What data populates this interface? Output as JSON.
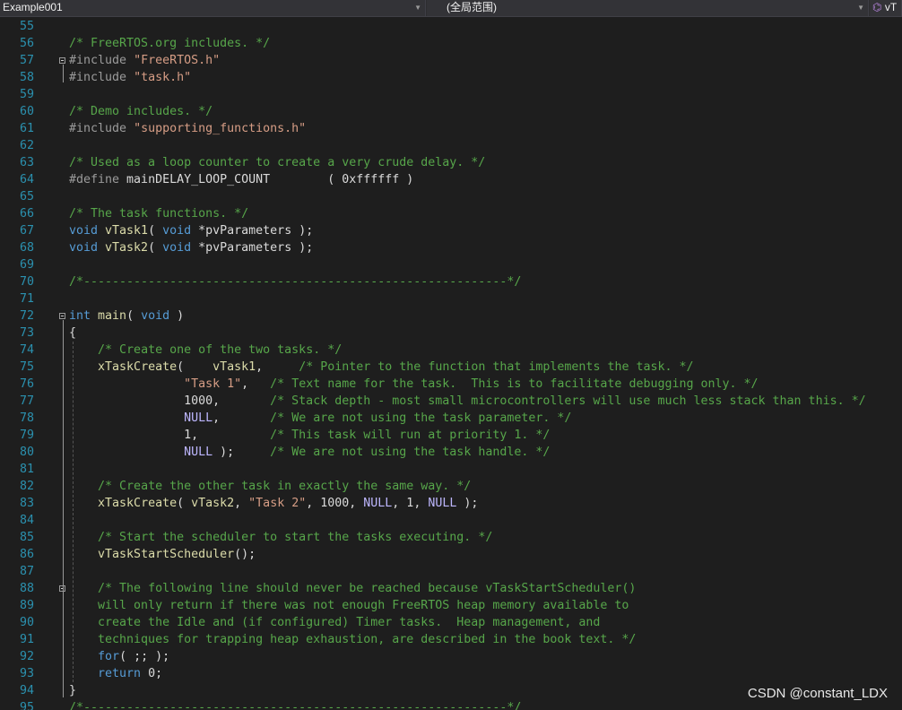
{
  "navbar": {
    "project": "Example001",
    "scope": "(全局范围)",
    "member": "vT",
    "member_icon": "method-icon"
  },
  "watermark": "CSDN @constant_LDX",
  "colors": {
    "background": "#1e1e1e",
    "line_number": "#2b91af",
    "comment": "#57a64a",
    "keyword": "#569cd6",
    "function": "#dcdcaa",
    "string": "#d69d85",
    "macro": "#beb7ff"
  },
  "lines": [
    {
      "n": "55",
      "t": []
    },
    {
      "n": "56",
      "t": [
        [
          "comment",
          "/* FreeRTOS.org includes. */"
        ]
      ]
    },
    {
      "n": "57",
      "t": [
        [
          "pp",
          "#include "
        ],
        [
          "str",
          "\"FreeRTOS.h\""
        ]
      ]
    },
    {
      "n": "58",
      "t": [
        [
          "pp",
          "#include "
        ],
        [
          "str",
          "\"task.h\""
        ]
      ]
    },
    {
      "n": "59",
      "t": []
    },
    {
      "n": "60",
      "t": [
        [
          "comment",
          "/* Demo includes. */"
        ]
      ]
    },
    {
      "n": "61",
      "t": [
        [
          "pp",
          "#include "
        ],
        [
          "str",
          "\"supporting_functions.h\""
        ]
      ]
    },
    {
      "n": "62",
      "t": []
    },
    {
      "n": "63",
      "t": [
        [
          "comment",
          "/* Used as a loop counter to create a very crude delay. */"
        ]
      ]
    },
    {
      "n": "64",
      "t": [
        [
          "pp",
          "#define "
        ],
        [
          "plain",
          "mainDELAY_LOOP_COUNT        ( 0xffffff )"
        ]
      ]
    },
    {
      "n": "65",
      "t": []
    },
    {
      "n": "66",
      "t": [
        [
          "comment",
          "/* The task functions. */"
        ]
      ]
    },
    {
      "n": "67",
      "t": [
        [
          "kw",
          "void "
        ],
        [
          "fn",
          "vTask1"
        ],
        [
          "plain",
          "( "
        ],
        [
          "kw",
          "void "
        ],
        [
          "plain",
          "*pvParameters );"
        ]
      ]
    },
    {
      "n": "68",
      "t": [
        [
          "kw",
          "void "
        ],
        [
          "fn",
          "vTask2"
        ],
        [
          "plain",
          "( "
        ],
        [
          "kw",
          "void "
        ],
        [
          "plain",
          "*pvParameters );"
        ]
      ]
    },
    {
      "n": "69",
      "t": []
    },
    {
      "n": "70",
      "t": [
        [
          "comment",
          "/*-----------------------------------------------------------*/"
        ]
      ]
    },
    {
      "n": "71",
      "t": []
    },
    {
      "n": "72",
      "t": [
        [
          "kw",
          "int "
        ],
        [
          "fn",
          "main"
        ],
        [
          "plain",
          "( "
        ],
        [
          "kw",
          "void "
        ],
        [
          "plain",
          ")"
        ]
      ]
    },
    {
      "n": "73",
      "t": [
        [
          "plain",
          "{"
        ]
      ]
    },
    {
      "n": "74",
      "t": [
        [
          "plain",
          "    "
        ],
        [
          "comment",
          "/* Create one of the two tasks. */"
        ]
      ]
    },
    {
      "n": "75",
      "t": [
        [
          "plain",
          "    "
        ],
        [
          "fn",
          "xTaskCreate"
        ],
        [
          "plain",
          "(    "
        ],
        [
          "fn",
          "vTask1"
        ],
        [
          "plain",
          ",     "
        ],
        [
          "comment",
          "/* Pointer to the function that implements the task. */"
        ]
      ]
    },
    {
      "n": "76",
      "t": [
        [
          "plain",
          "                "
        ],
        [
          "str",
          "\"Task 1\""
        ],
        [
          "plain",
          ",   "
        ],
        [
          "comment",
          "/* Text name for the task.  This is to facilitate debugging only. */"
        ]
      ]
    },
    {
      "n": "77",
      "t": [
        [
          "plain",
          "                1000,       "
        ],
        [
          "comment",
          "/* Stack depth - most small microcontrollers will use much less stack than this. */"
        ]
      ]
    },
    {
      "n": "78",
      "t": [
        [
          "plain",
          "                "
        ],
        [
          "macro",
          "NULL"
        ],
        [
          "plain",
          ",       "
        ],
        [
          "comment",
          "/* We are not using the task parameter. */"
        ]
      ]
    },
    {
      "n": "79",
      "t": [
        [
          "plain",
          "                1,          "
        ],
        [
          "comment",
          "/* This task will run at priority 1. */"
        ]
      ]
    },
    {
      "n": "80",
      "t": [
        [
          "plain",
          "                "
        ],
        [
          "macro",
          "NULL"
        ],
        [
          "plain",
          " );     "
        ],
        [
          "comment",
          "/* We are not using the task handle. */"
        ]
      ]
    },
    {
      "n": "81",
      "t": []
    },
    {
      "n": "82",
      "t": [
        [
          "plain",
          "    "
        ],
        [
          "comment",
          "/* Create the other task in exactly the same way. */"
        ]
      ]
    },
    {
      "n": "83",
      "t": [
        [
          "plain",
          "    "
        ],
        [
          "fn",
          "xTaskCreate"
        ],
        [
          "plain",
          "( "
        ],
        [
          "fn",
          "vTask2"
        ],
        [
          "plain",
          ", "
        ],
        [
          "str",
          "\"Task 2\""
        ],
        [
          "plain",
          ", 1000, "
        ],
        [
          "macro",
          "NULL"
        ],
        [
          "plain",
          ", 1, "
        ],
        [
          "macro",
          "NULL"
        ],
        [
          "plain",
          " );"
        ]
      ]
    },
    {
      "n": "84",
      "t": []
    },
    {
      "n": "85",
      "t": [
        [
          "plain",
          "    "
        ],
        [
          "comment",
          "/* Start the scheduler to start the tasks executing. */"
        ]
      ]
    },
    {
      "n": "86",
      "t": [
        [
          "plain",
          "    "
        ],
        [
          "fn",
          "vTaskStartScheduler"
        ],
        [
          "plain",
          "();"
        ]
      ]
    },
    {
      "n": "87",
      "t": []
    },
    {
      "n": "88",
      "t": [
        [
          "plain",
          "    "
        ],
        [
          "comment",
          "/* The following line should never be reached because vTaskStartScheduler()"
        ]
      ]
    },
    {
      "n": "89",
      "t": [
        [
          "comment",
          "    will only return if there was not enough FreeRTOS heap memory available to"
        ]
      ]
    },
    {
      "n": "90",
      "t": [
        [
          "comment",
          "    create the Idle and (if configured) Timer tasks.  Heap management, and"
        ]
      ]
    },
    {
      "n": "91",
      "t": [
        [
          "comment",
          "    techniques for trapping heap exhaustion, are described in the book text. */"
        ]
      ]
    },
    {
      "n": "92",
      "t": [
        [
          "plain",
          "    "
        ],
        [
          "kw",
          "for"
        ],
        [
          "plain",
          "( ;; );"
        ]
      ]
    },
    {
      "n": "93",
      "t": [
        [
          "plain",
          "    "
        ],
        [
          "kw",
          "return "
        ],
        [
          "plain",
          "0;"
        ]
      ]
    },
    {
      "n": "94",
      "t": [
        [
          "plain",
          "}"
        ]
      ]
    },
    {
      "n": "95",
      "t": [
        [
          "comment",
          "/*-----------------------------------------------------------*/"
        ]
      ]
    }
  ]
}
